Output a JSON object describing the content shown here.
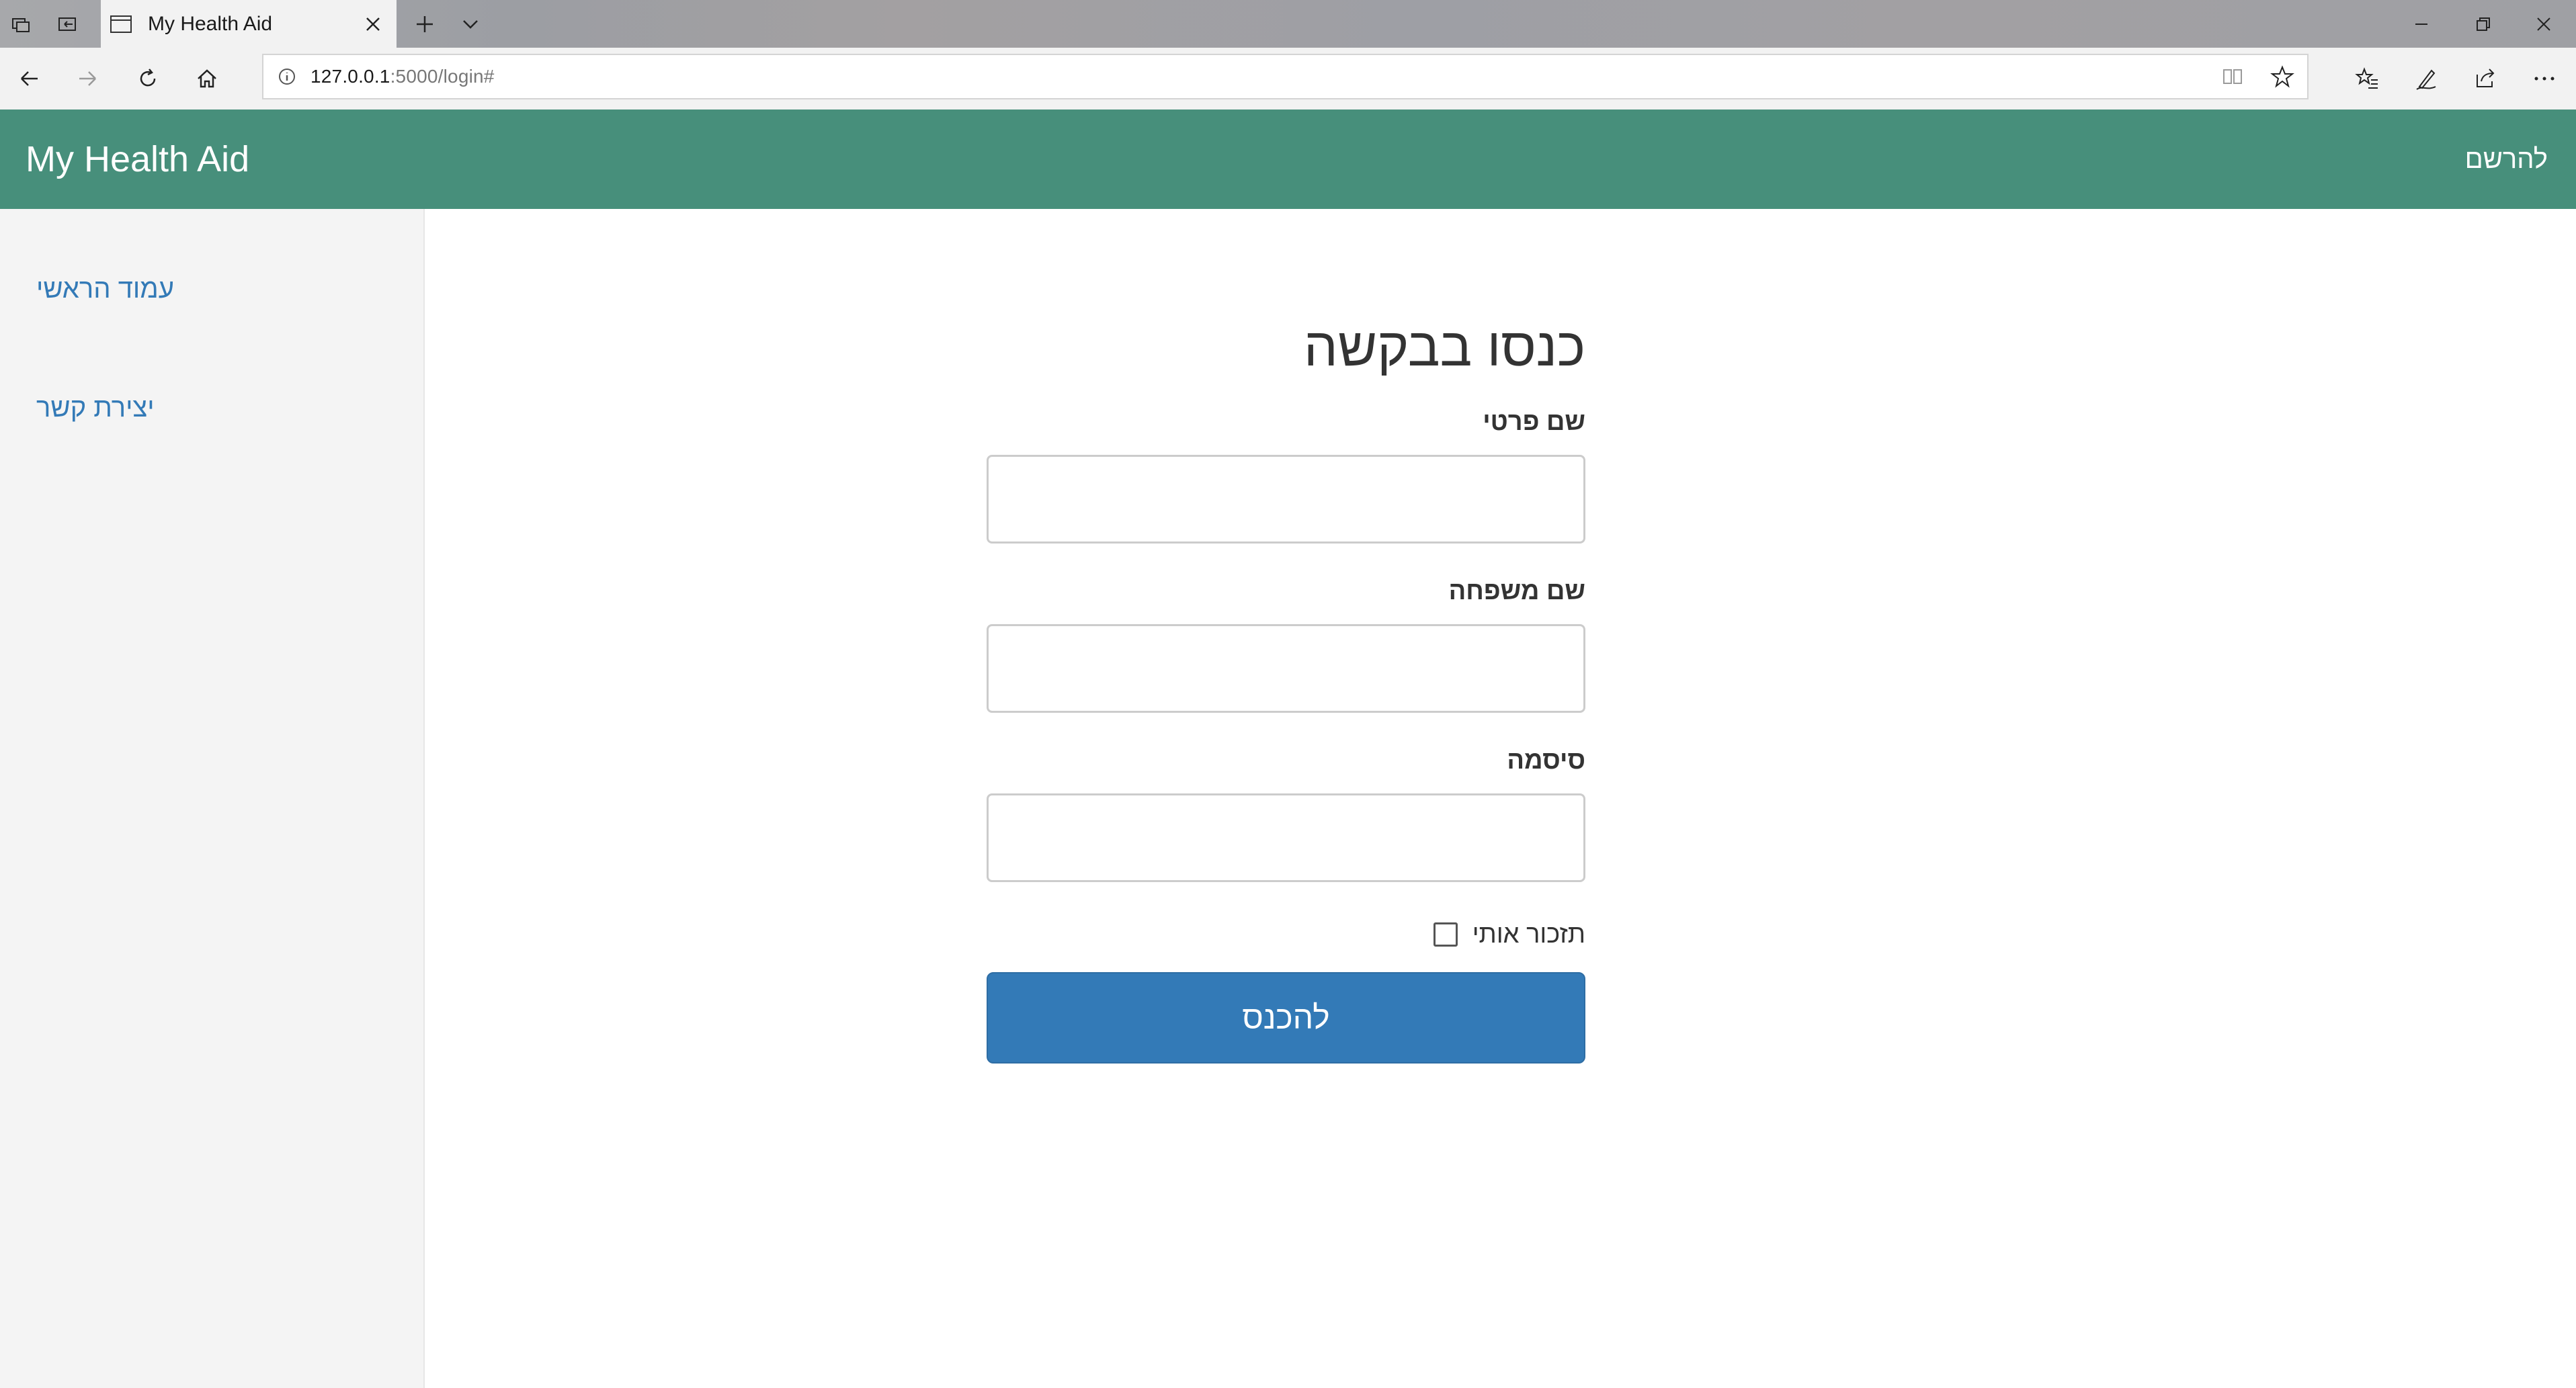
{
  "browser": {
    "tab": {
      "title": "My Health Aid"
    },
    "address": {
      "host": "127.0.0.1",
      "path": ":5000/login#"
    }
  },
  "navbar": {
    "brand": "My Health Aid",
    "register_link": "להרשם"
  },
  "sidebar": {
    "items": [
      {
        "label": "עמוד הראשי"
      },
      {
        "label": "יצירת קשר"
      }
    ]
  },
  "login_form": {
    "title": "כנסו בבקשה",
    "first_name_label": "שם פרטי",
    "last_name_label": "שם משפחה",
    "password_label": "סיסמה",
    "remember_label": "תזכור אותי",
    "submit_label": "להכנס"
  },
  "colors": {
    "navbar_bg": "#478f7b",
    "link": "#337ab7",
    "button_bg": "#337ab7",
    "sidebar_bg": "#f4f4f4"
  }
}
